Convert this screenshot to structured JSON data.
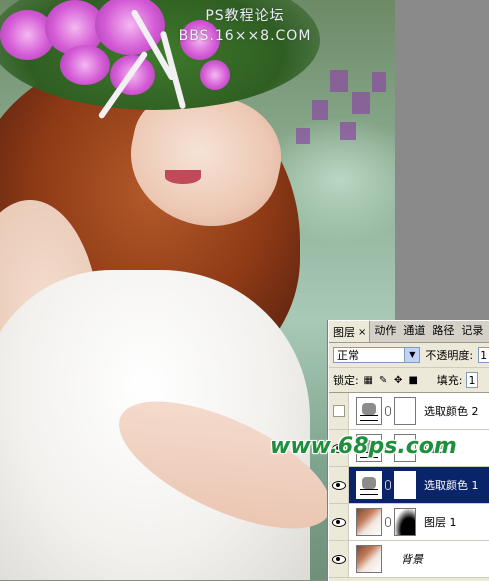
{
  "watermark": {
    "line1": "PS教程论坛",
    "line2": "BBS.16××8.COM",
    "site": "www.68ps.com"
  },
  "panel": {
    "tabs": [
      {
        "label": "图层",
        "close": "×"
      },
      {
        "label": "动作"
      },
      {
        "label": "通道"
      },
      {
        "label": "路径"
      },
      {
        "label": "记录"
      }
    ],
    "blend_mode": "正常",
    "opacity_label": "不透明度:",
    "opacity_value": "1",
    "lock_label": "锁定:",
    "fill_label": "填充:",
    "fill_value": "1",
    "layers": [
      {
        "name": "选取颜色 2",
        "visible": false,
        "type": "adjustment",
        "selected": false
      },
      {
        "name": "曲线 1",
        "visible": true,
        "type": "adjustment",
        "selected": false
      },
      {
        "name": "选取颜色 1",
        "visible": true,
        "type": "adjustment",
        "selected": true
      },
      {
        "name": "图层 1",
        "visible": true,
        "type": "photo-mask",
        "selected": false
      },
      {
        "name": "背景",
        "visible": true,
        "type": "photo",
        "selected": false
      }
    ]
  },
  "colors": {
    "selection": "#0a246a",
    "panel_bg": "#ece9d8",
    "watermark_site": "#1e8f3a"
  }
}
